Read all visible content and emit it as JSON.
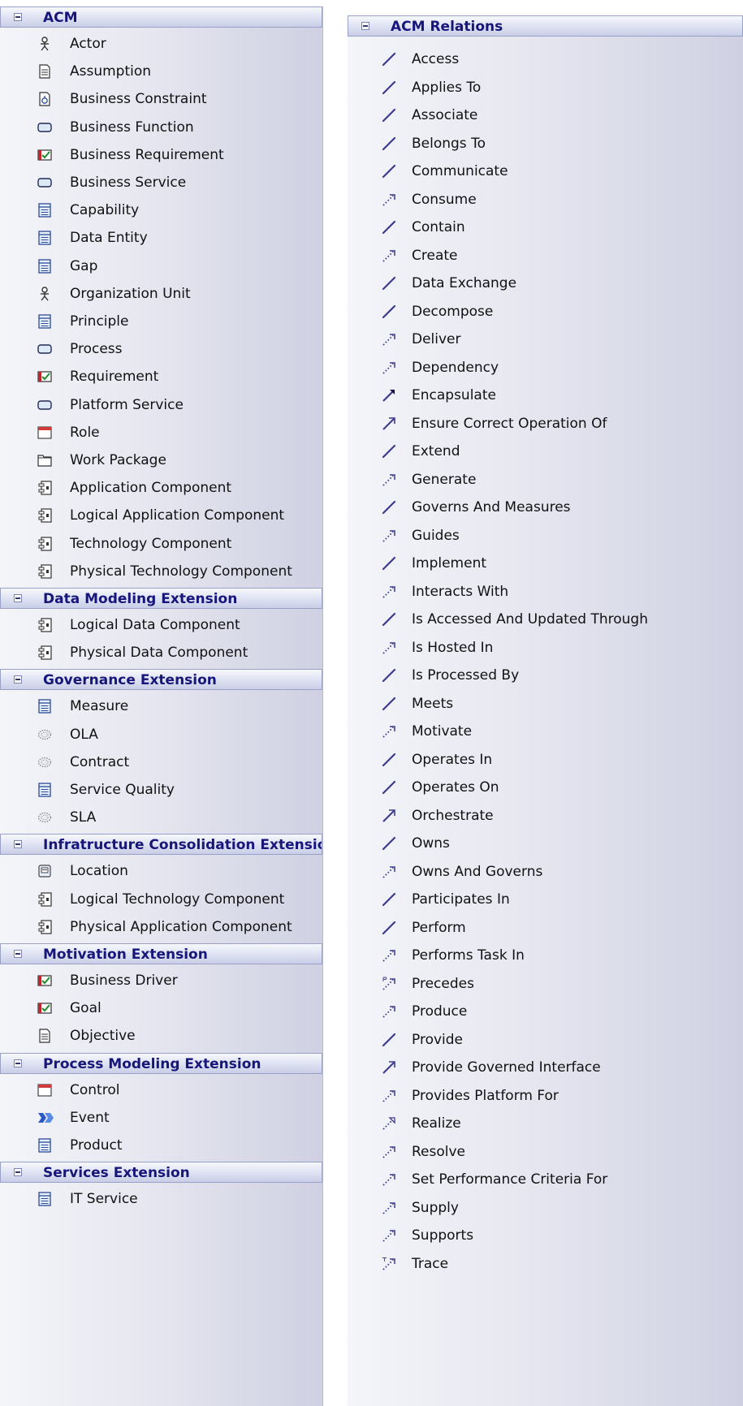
{
  "left_toolbox": {
    "categories": [
      {
        "title": "ACM",
        "items": [
          {
            "label": "Actor",
            "icon": "actor-icon"
          },
          {
            "label": "Assumption",
            "icon": "document-icon"
          },
          {
            "label": "Business Constraint",
            "icon": "constraint-icon"
          },
          {
            "label": "Business Function",
            "icon": "rounded-box-icon"
          },
          {
            "label": "Business Requirement",
            "icon": "requirement-icon"
          },
          {
            "label": "Business Service",
            "icon": "rounded-box-icon"
          },
          {
            "label": "Capability",
            "icon": "class-icon"
          },
          {
            "label": "Data Entity",
            "icon": "class-icon"
          },
          {
            "label": "Gap",
            "icon": "class-icon"
          },
          {
            "label": "Organization Unit",
            "icon": "actor-icon"
          },
          {
            "label": "Principle",
            "icon": "class-icon"
          },
          {
            "label": "Process",
            "icon": "rounded-box-icon"
          },
          {
            "label": "Requirement",
            "icon": "requirement-icon"
          },
          {
            "label": "Platform Service",
            "icon": "rounded-box-icon"
          },
          {
            "label": "Role",
            "icon": "role-icon"
          },
          {
            "label": "Work Package",
            "icon": "package-icon"
          },
          {
            "label": "Application Component",
            "icon": "component-icon"
          },
          {
            "label": "Logical Application Component",
            "icon": "component-icon"
          },
          {
            "label": "Technology Component",
            "icon": "component-icon"
          },
          {
            "label": "Physical Technology Component",
            "icon": "component-icon"
          }
        ]
      },
      {
        "title": "Data Modeling Extension",
        "items": [
          {
            "label": "Logical Data Component",
            "icon": "component-icon"
          },
          {
            "label": "Physical Data Component",
            "icon": "component-icon"
          }
        ]
      },
      {
        "title": "Governance Extension",
        "items": [
          {
            "label": "Measure",
            "icon": "class-icon"
          },
          {
            "label": "OLA",
            "icon": "dotted-ellipse-icon"
          },
          {
            "label": "Contract",
            "icon": "dotted-ellipse-icon"
          },
          {
            "label": "Service Quality",
            "icon": "class-icon"
          },
          {
            "label": "SLA",
            "icon": "dotted-ellipse-icon"
          }
        ]
      },
      {
        "title": "Infratructure Consolidation Extension",
        "items": [
          {
            "label": "Location",
            "icon": "location-icon"
          },
          {
            "label": "Logical Technology Component",
            "icon": "component-icon"
          },
          {
            "label": "Physical Application Component",
            "icon": "component-icon"
          }
        ]
      },
      {
        "title": "Motivation Extension",
        "items": [
          {
            "label": "Business Driver",
            "icon": "requirement-icon"
          },
          {
            "label": "Goal",
            "icon": "requirement-icon"
          },
          {
            "label": "Objective",
            "icon": "document-icon"
          }
        ]
      },
      {
        "title": "Process Modeling Extension",
        "items": [
          {
            "label": "Control",
            "icon": "role-icon"
          },
          {
            "label": "Event",
            "icon": "event-icon"
          },
          {
            "label": "Product",
            "icon": "class-icon"
          }
        ]
      },
      {
        "title": "Services Extension",
        "items": [
          {
            "label": "IT Service",
            "icon": "class-icon"
          }
        ]
      }
    ]
  },
  "right_toolbox": {
    "title": "ACM Relations",
    "items": [
      {
        "label": "Access",
        "icon": "solid-line-icon"
      },
      {
        "label": "Applies To",
        "icon": "solid-line-icon"
      },
      {
        "label": "Associate",
        "icon": "solid-line-icon"
      },
      {
        "label": "Belongs To",
        "icon": "solid-line-icon"
      },
      {
        "label": "Communicate",
        "icon": "solid-line-icon"
      },
      {
        "label": "Consume",
        "icon": "dashed-arrow-icon"
      },
      {
        "label": "Contain",
        "icon": "solid-line-icon"
      },
      {
        "label": "Create",
        "icon": "dashed-arrow-icon"
      },
      {
        "label": "Data Exchange",
        "icon": "solid-line-icon"
      },
      {
        "label": "Decompose",
        "icon": "solid-line-icon"
      },
      {
        "label": "Deliver",
        "icon": "dashed-arrow-icon"
      },
      {
        "label": "Dependency",
        "icon": "dashed-arrow-icon"
      },
      {
        "label": "Encapsulate",
        "icon": "composition-icon"
      },
      {
        "label": "Ensure Correct Operation Of",
        "icon": "solid-arrow-icon"
      },
      {
        "label": "Extend",
        "icon": "solid-line-icon"
      },
      {
        "label": "Generate",
        "icon": "dashed-arrow-icon"
      },
      {
        "label": "Governs And Measures",
        "icon": "solid-line-icon"
      },
      {
        "label": "Guides",
        "icon": "dashed-arrow-icon"
      },
      {
        "label": "Implement",
        "icon": "solid-line-icon"
      },
      {
        "label": "Interacts With",
        "icon": "dashed-arrow-icon"
      },
      {
        "label": "Is Accessed And Updated Through",
        "icon": "solid-line-icon"
      },
      {
        "label": "Is Hosted In",
        "icon": "dashed-arrow-icon"
      },
      {
        "label": "Is Processed By",
        "icon": "solid-line-icon"
      },
      {
        "label": "Meets",
        "icon": "solid-line-icon"
      },
      {
        "label": "Motivate",
        "icon": "dashed-arrow-icon"
      },
      {
        "label": "Operates In",
        "icon": "solid-line-icon"
      },
      {
        "label": "Operates On",
        "icon": "solid-line-icon"
      },
      {
        "label": "Orchestrate",
        "icon": "solid-arrow-icon"
      },
      {
        "label": "Owns",
        "icon": "solid-line-icon"
      },
      {
        "label": "Owns And Governs",
        "icon": "dashed-arrow-icon"
      },
      {
        "label": "Participates In",
        "icon": "solid-line-icon"
      },
      {
        "label": "Perform",
        "icon": "solid-line-icon"
      },
      {
        "label": "Performs Task In",
        "icon": "dashed-arrow-icon"
      },
      {
        "label": "Precedes",
        "icon": "precedes-icon"
      },
      {
        "label": "Produce",
        "icon": "dashed-arrow-icon"
      },
      {
        "label": "Provide",
        "icon": "solid-line-icon"
      },
      {
        "label": "Provide Governed Interface",
        "icon": "solid-arrow-icon"
      },
      {
        "label": "Provides Platform For",
        "icon": "dashed-arrow-icon"
      },
      {
        "label": "Realize",
        "icon": "realize-icon"
      },
      {
        "label": "Resolve",
        "icon": "dashed-arrow-icon"
      },
      {
        "label": "Set Performance Criteria For",
        "icon": "dashed-arrow-icon"
      },
      {
        "label": "Supply",
        "icon": "dashed-arrow-icon"
      },
      {
        "label": "Supports",
        "icon": "dashed-arrow-icon"
      },
      {
        "label": "Trace",
        "icon": "trace-icon"
      }
    ]
  },
  "colors": {
    "header_text": "#17167a",
    "header_border": "#9aa1c6",
    "relation_line": "#3b3a8f"
  }
}
